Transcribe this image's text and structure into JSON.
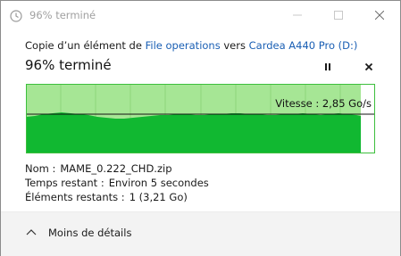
{
  "window": {
    "title": "96% terminé"
  },
  "header": {
    "copy_prefix": "Copie d’un élément de",
    "source": "File operations",
    "copy_middle": "vers",
    "destination": "Cardea A440 Pro (D:)",
    "progress_title": "96% terminé"
  },
  "progress": {
    "percent": 96,
    "speed_label": "Vitesse : 2,85 Go/s"
  },
  "details": {
    "name_label": "Nom :",
    "name_value": "MAME_0.222_CHD.zip",
    "time_label": "Temps restant :",
    "time_value": "Environ 5 secondes",
    "items_label": "Éléments restants :",
    "items_value": "1 (3,21 Go)"
  },
  "footer": {
    "toggle_label": "Moins de détails"
  },
  "colors": {
    "graph_fill": "#11b831",
    "graph_background": "#a6e695",
    "graph_border": "#3dbf3d",
    "link": "#1a5fb4"
  },
  "icons": {
    "window": "copy-clock-icon",
    "minimize": "minimize-icon",
    "maximize": "maximize-icon",
    "close": "close-icon",
    "pause": "pause-icon",
    "cancel": "cancel-icon",
    "details": "chevron-up-icon"
  }
}
